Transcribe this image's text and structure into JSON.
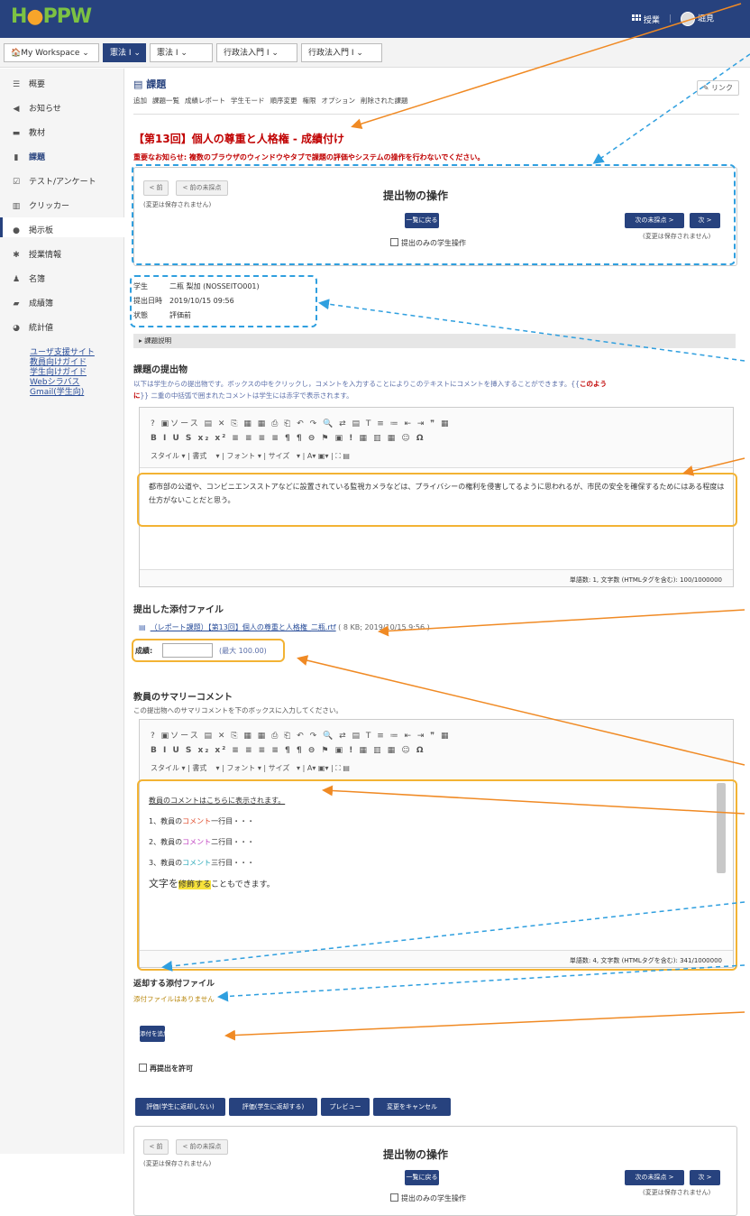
{
  "app": {
    "logo_main": "H",
    "logo_rest": "PP",
    "logo_tail": "W",
    "user_menu": "授業",
    "user_name": "堀見"
  },
  "site_tabs": [
    "My Workspace",
    "憲法 I",
    "憲法 I",
    "行政法入門 I",
    "行政法入門 I"
  ],
  "sidebar": {
    "items": [
      "概要",
      "お知らせ",
      "教材",
      "課題",
      "テスト/アンケート",
      "クリッカー",
      "掲示板",
      "授業情報",
      "名簿",
      "成績簿",
      "統計値"
    ],
    "links": [
      "ユーザ支援サイト",
      "教員向けガイド",
      "学生向けガイド",
      "Webシラバス",
      "Gmail(学生向)"
    ]
  },
  "page": {
    "tool_title": "課題",
    "link_button": "リンク",
    "sub_tabs": [
      "追加",
      "課題一覧",
      "成績レポート",
      "学生モード",
      "順序変更",
      "権限",
      "オプション",
      "削除された課題"
    ],
    "heading": "【第13回】個人の尊重と人格権 - 成績付け",
    "warning": "重要なお知らせ: 複数のブラウザのウィンドウやタブで課題の評価やシステムの操作を行わないでください。"
  },
  "nav_panel": {
    "title": "提出物の操作",
    "prev": "< 前",
    "prev_ungraded": "< 前の未採点",
    "unsaved_left": "(変更は保存されません)",
    "back_to_list": "一覧に戻る",
    "next_ungraded": "次の未採点 >",
    "next": "次 >",
    "unsaved_right": "(変更は保存されません)",
    "only_submitted": "提出のみの学生操作"
  },
  "student_info": {
    "student_label": "学生",
    "student_value": "二瓶 梨加 (NOSSEITO001)",
    "date_label": "提出日時",
    "date_value": "2019/10/15 09:56",
    "status_label": "状態",
    "status_value": "評価前"
  },
  "collapse_bar": "課題説明",
  "submission": {
    "heading": "課題の提出物",
    "instructions_1": "以下は学生からの提出物です。ボックスの中をクリックし，コメントを入力することによりこのテキストにコメントを挿入することができます。{{",
    "instructions_red": "このよう",
    "instructions_red2": "に",
    "instructions_2": "}} 二重の中括弧で囲まれたコメントは学生には赤字で表示されます。",
    "text": "都市部の公道や、コンビニエンスストアなどに設置されている監視カメラなどは、プライバシーの権利を侵害してるように思われるが、市民の安全を確保するためにはある程度は仕方がないことだと思う。",
    "word_count": "単語数: 1, 文字数 (HTMLタグを含む): 100/1000000"
  },
  "editor_toolbar": {
    "row1": "? ▣ソース ▤ ✕ ⎘ ▦ ▦ ⎙ ⎗ ↶ ↷ 🔍 ⇄ ▤ T ≡ ≔ ⇤ ⇥ ❞ ▦",
    "row2": "B I U S x₂ x² ≡ ≡ ≡ ≡ ¶ ¶ ⊖ ⚑ ▣ ! ▦ ▥ ▦ ☺ Ω",
    "style": "スタイル",
    "format": "書式",
    "font": "フォント",
    "size": "サイズ"
  },
  "attachments": {
    "heading": "提出した添付ファイル",
    "file_link": "（レポート課題）【第13回】個人の尊重と人格権_二瓶.rtf",
    "file_meta": "( 8 KB; 2019/10/15 9:56 )"
  },
  "grade": {
    "label": "成績:",
    "value": "",
    "max": "(最大 100.00)"
  },
  "summary": {
    "heading": "教員のサマリーコメント",
    "instruction": "この提出物へのサマリコメントを下のボックスに入力してください。",
    "line0": "教員のコメントはこちらに表示されます。",
    "line1_a": "1、教員の",
    "line1_b": "コメント",
    "line1_c": "一行目・・・",
    "line2_a": "2、教員の",
    "line2_b": "コメント",
    "line2_c": "二行目・・・",
    "line3_a": "3、教員の",
    "line3_b": "コメント",
    "line3_c": "三行目・・・",
    "line4_a": "文字を",
    "line4_b": "修飾する",
    "line4_c": "こともできます。",
    "word_count": "単語数: 4, 文字数 (HTMLタグを含む): 341/1000000"
  },
  "return_files": {
    "heading": "返却する添付ファイル",
    "none": "添付ファイルはありません",
    "add_button": "添付を追加"
  },
  "resubmit": {
    "label": "再提出を許可"
  },
  "actions": {
    "save_hidden": "評価(学生に返却しない)",
    "save_return": "評価(学生に返却する)",
    "preview": "プレビュー",
    "cancel": "変更をキャンセル"
  },
  "colors": {
    "navy": "#27427e",
    "annotation_blue": "#2f9fdf",
    "annotation_orange": "#f08a24",
    "highlight_yellow": "#f3b334",
    "warning_red": "#c00000"
  }
}
